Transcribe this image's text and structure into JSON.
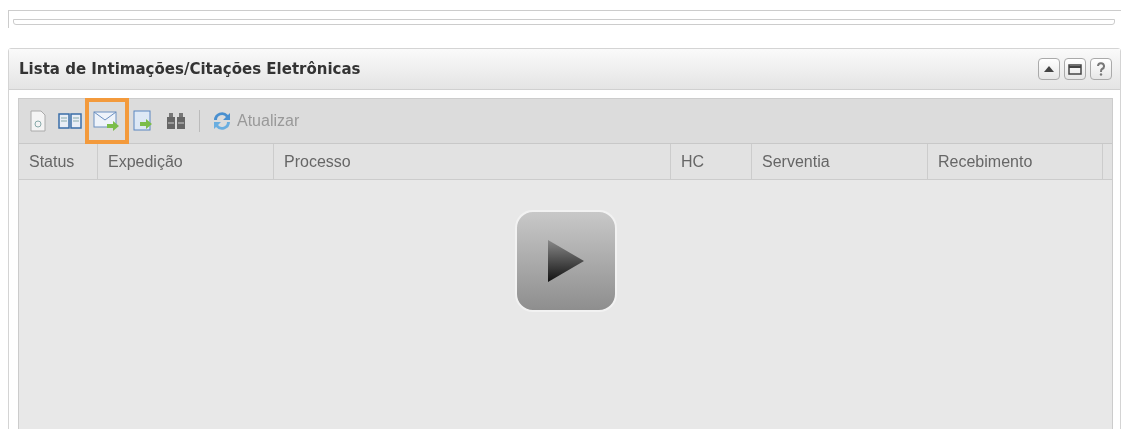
{
  "panel": {
    "title": "Lista de Intimações/Citações Eletrônicas",
    "header_buttons": [
      {
        "kind": "collapse"
      },
      {
        "kind": "maximize"
      },
      {
        "kind": "help"
      }
    ]
  },
  "toolbar": {
    "tools": [
      {
        "kind": "document",
        "highlighted": false
      },
      {
        "kind": "book",
        "highlighted": false
      },
      {
        "kind": "mail",
        "highlighted": true
      },
      {
        "kind": "export",
        "highlighted": false
      },
      {
        "kind": "binoculars",
        "highlighted": false
      }
    ],
    "refresh_label": "Atualizar"
  },
  "table": {
    "columns": [
      "Status",
      "Expedição",
      "Processo",
      "HC",
      "Serventia",
      "Recebimento"
    ]
  },
  "player": {
    "kind": "play"
  }
}
